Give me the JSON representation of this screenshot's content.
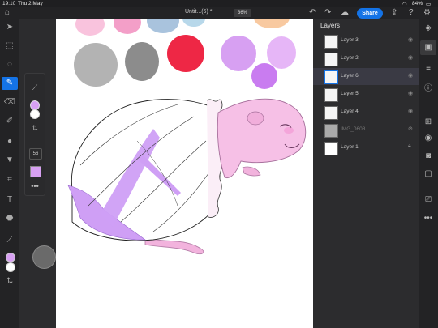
{
  "status": {
    "time": "19:10",
    "date": "Thu 2 May",
    "battery": "84%"
  },
  "topbar": {
    "title": "Untit...(6) *",
    "zoom": "36%",
    "share_label": "Share"
  },
  "left_tools": [
    "home-icon",
    "select-icon",
    "transform-icon",
    "lasso-icon",
    "brush-icon",
    "eraser-icon",
    "smudge-icon",
    "blur-icon",
    "fill-icon",
    "crop-icon",
    "type-icon",
    "liquify-icon",
    "eyedropper-icon"
  ],
  "brush_panel": {
    "size": "56",
    "menu": "•••"
  },
  "colors": {
    "primary": "#d7a0f2",
    "secondary": "#ffffff",
    "accent": "#1473e6",
    "panel": "#2c2c2e"
  },
  "layers": {
    "title": "Layers",
    "items": [
      {
        "name": "Layer 3",
        "status": "visible"
      },
      {
        "name": "Layer 2",
        "status": "visible"
      },
      {
        "name": "Layer 6",
        "status": "visible",
        "selected": true
      },
      {
        "name": "Layer 5",
        "status": "visible"
      },
      {
        "name": "Layer 4",
        "status": "visible"
      },
      {
        "name": "IMG_0608",
        "status": "hidden"
      },
      {
        "name": "Layer 1",
        "status": "locked"
      }
    ]
  },
  "canvas_palette": [
    "#f9c3dd",
    "#f39fc8",
    "#a9c3dd",
    "#b8d8ea",
    "#f8c9a0",
    "#b3b3b3",
    "#8c8c8c",
    "#ee2745",
    "#d7a0f2",
    "#e6b6f7",
    "#c97cf0"
  ]
}
